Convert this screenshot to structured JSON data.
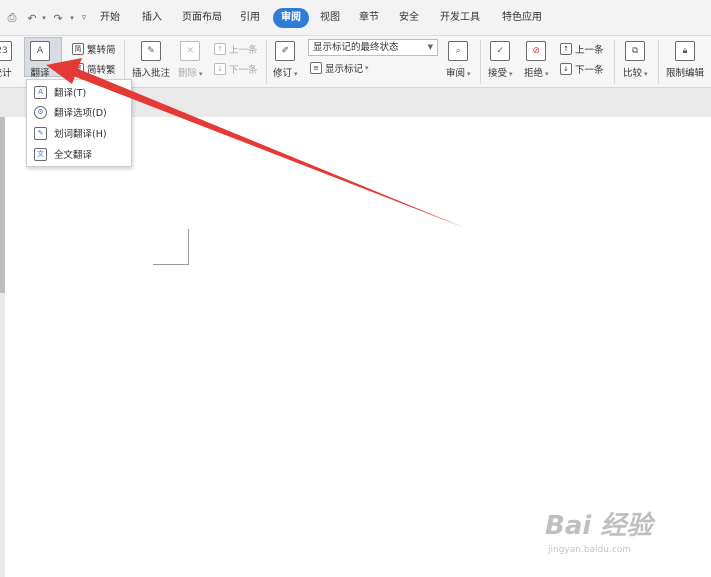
{
  "quick_access": [
    "preview-icon",
    "undo-icon",
    "redo-icon",
    "customize-icon"
  ],
  "tabs": [
    {
      "label": "开始"
    },
    {
      "label": "插入"
    },
    {
      "label": "页面布局"
    },
    {
      "label": "引用"
    },
    {
      "label": "审阅",
      "active": true
    },
    {
      "label": "视图"
    },
    {
      "label": "章节"
    },
    {
      "label": "安全"
    },
    {
      "label": "开发工具"
    },
    {
      "label": "特色应用"
    }
  ],
  "ribbon": {
    "word_count": {
      "label": "统计",
      "icon_text": "23"
    },
    "translate": {
      "label": "翻译",
      "icon_text": "A"
    },
    "trad_to_simp": "繁转简",
    "simp_to_trad": "简转繁",
    "insert_comment": "插入批注",
    "delete": "删除",
    "prev_comment": "上一条",
    "next_comment": "下一条",
    "track_changes": "修订",
    "display_mode": "显示标记的最终状态",
    "show_markup": "显示标记",
    "review_pane": "审阅",
    "accept": "接受",
    "reject": "拒绝",
    "prev_change": "上一条",
    "next_change": "下一条",
    "compare": "比较",
    "restrict_editing": "限制编辑"
  },
  "translate_menu": {
    "items": [
      {
        "label": "翻译(T)"
      },
      {
        "label": "翻译选项(D)"
      },
      {
        "label": "划词翻译(H)"
      },
      {
        "label": "全文翻译"
      }
    ]
  },
  "watermark": {
    "logo": "Bai 经验",
    "url": "jingyan.baidu.com"
  },
  "colors": {
    "accent": "#2f7bd8",
    "arrow": "#e53935"
  }
}
